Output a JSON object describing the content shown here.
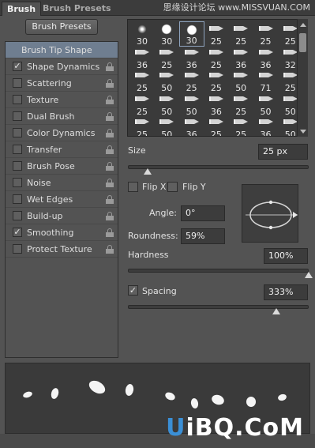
{
  "tabs": [
    {
      "label": "Brush",
      "active": true
    },
    {
      "label": "Brush Presets",
      "active": false
    }
  ],
  "watermark": "思缘设计论坛 www.MISSVUAN.COM",
  "brush_presets_button": "Brush Presets",
  "settings_list": [
    {
      "label": "Brush Tip Shape",
      "header": true
    },
    {
      "label": "Shape Dynamics",
      "checked": true
    },
    {
      "label": "Scattering",
      "checked": false
    },
    {
      "label": "Texture",
      "checked": false
    },
    {
      "label": "Dual Brush",
      "checked": false
    },
    {
      "label": "Color Dynamics",
      "checked": false
    },
    {
      "label": "Transfer",
      "checked": false
    },
    {
      "label": "Brush Pose",
      "checked": false
    },
    {
      "label": "Noise",
      "checked": false
    },
    {
      "label": "Wet Edges",
      "checked": false
    },
    {
      "label": "Build-up",
      "checked": false
    },
    {
      "label": "Smoothing",
      "checked": true
    },
    {
      "label": "Protect Texture",
      "checked": false
    }
  ],
  "brush_grid": {
    "rows": [
      [
        "30",
        "30",
        "30",
        "25",
        "25",
        "25",
        "25"
      ],
      [
        "36",
        "25",
        "36",
        "25",
        "36",
        "36",
        "32"
      ],
      [
        "25",
        "50",
        "25",
        "25",
        "50",
        "71",
        "25"
      ],
      [
        "25",
        "50",
        "50",
        "36",
        "25",
        "50",
        "50"
      ],
      [
        "25",
        "50",
        "36",
        "25",
        "25",
        "36",
        "50"
      ]
    ],
    "selected_index": "0.2"
  },
  "size": {
    "label": "Size",
    "value": "25 px",
    "slider_fraction": 0.11
  },
  "flip_x": {
    "label": "Flip X",
    "checked": false
  },
  "flip_y": {
    "label": "Flip Y",
    "checked": false
  },
  "angle": {
    "label": "Angle:",
    "value": "0°"
  },
  "roundness": {
    "label": "Roundness:",
    "value": "59%"
  },
  "hardness": {
    "label": "Hardness",
    "value": "100%",
    "slider_fraction": 1.0
  },
  "spacing": {
    "label": "Spacing",
    "checked": true,
    "value": "333%",
    "slider_fraction": 0.82
  },
  "logo": {
    "text_u": "U",
    "text_rest": "iBQ.CoM"
  },
  "colors": {
    "panel": "#535353",
    "header_highlight": "#6f7e90",
    "well": "#3a3a3a"
  }
}
